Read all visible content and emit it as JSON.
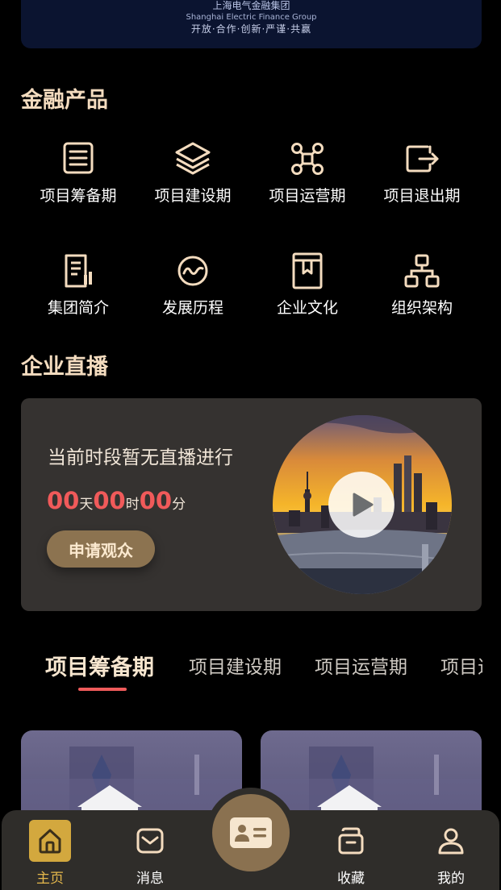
{
  "banner": {
    "company_cn": "上海电气金融集团",
    "company_en": "Shanghai Electric Finance Group",
    "slogan": "开放·合作·创新·严谨·共赢"
  },
  "finance_products": {
    "title": "金融产品",
    "row1": [
      {
        "label": "项目筹备期",
        "icon": "document-list-icon"
      },
      {
        "label": "项目建设期",
        "icon": "layers-icon"
      },
      {
        "label": "项目运营期",
        "icon": "network-nodes-icon"
      },
      {
        "label": "项目退出期",
        "icon": "exit-icon"
      }
    ],
    "row2": [
      {
        "label": "集团简介",
        "icon": "report-icon"
      },
      {
        "label": "发展历程",
        "icon": "trend-wave-icon"
      },
      {
        "label": "企业文化",
        "icon": "book-icon"
      },
      {
        "label": "组织架构",
        "icon": "org-chart-icon"
      }
    ]
  },
  "live": {
    "title": "企业直播",
    "message": "当前时段暂无直播进行",
    "countdown": {
      "days": "00",
      "days_unit": "天",
      "hours": "00",
      "hours_unit": "时",
      "minutes": "00",
      "minutes_unit": "分"
    },
    "apply_button": "申请观众"
  },
  "tabs": [
    "项目筹备期",
    "项目建设期",
    "项目运营期",
    "项目退出期"
  ],
  "active_tab": 0,
  "bottom_nav": [
    {
      "label": "主页",
      "icon": "home-icon",
      "active": true
    },
    {
      "label": "消息",
      "icon": "message-icon",
      "active": false
    },
    {
      "label": "",
      "icon": "id-card-icon",
      "active": false
    },
    {
      "label": "收藏",
      "icon": "archive-icon",
      "active": false
    },
    {
      "label": "我的",
      "icon": "user-icon",
      "active": false
    }
  ],
  "colors": {
    "accent_gold": "#f4dcbf",
    "countdown_red": "#f05a5a",
    "nav_active": "#d3a83e",
    "card_bg": "#353230"
  }
}
